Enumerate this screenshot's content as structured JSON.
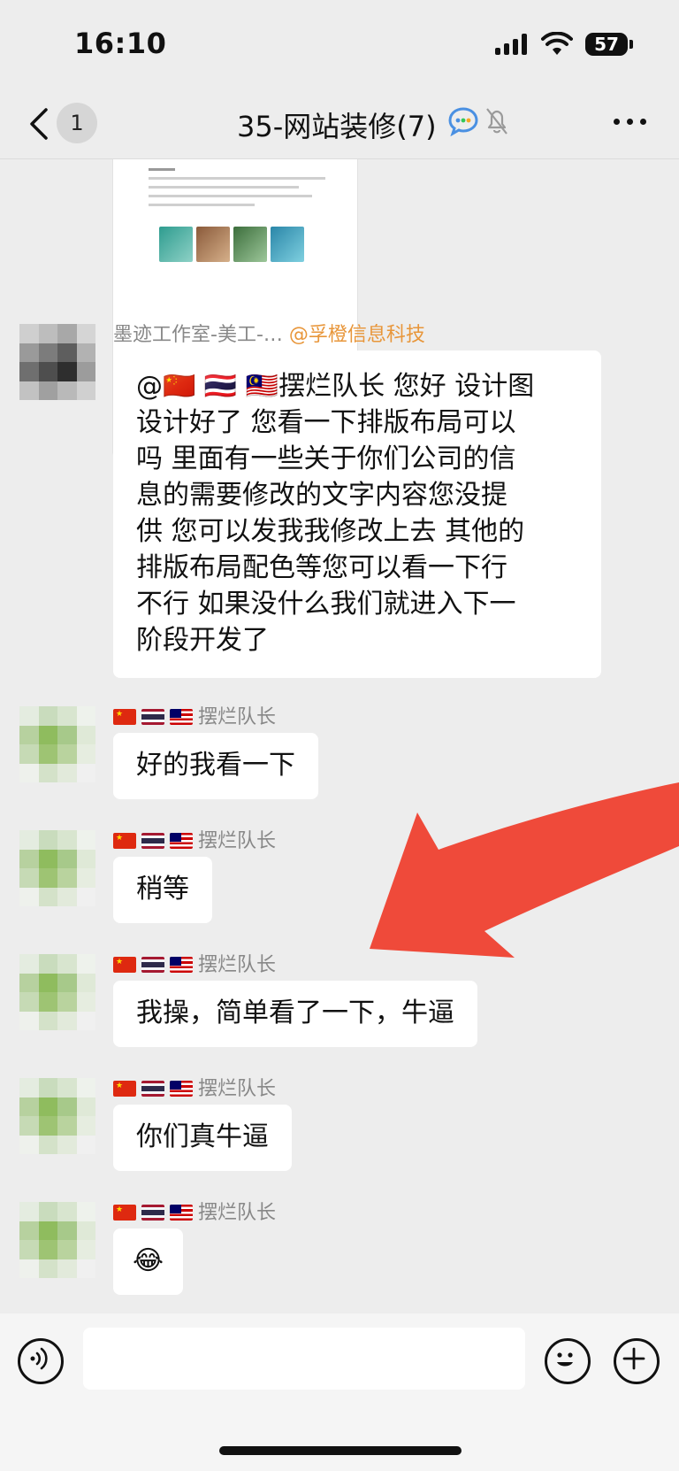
{
  "status": {
    "time": "16:10",
    "battery": "57"
  },
  "header": {
    "unread_count": "1",
    "title": "35-网站装修(7)"
  },
  "messages": [
    {
      "sender": "墨迹工作室-美工-…",
      "tag": "@孚橙信息科技",
      "lines": [
        "@🇨🇳 🇹🇭 🇲🇾摆烂队长 您好 设计图",
        "设计好了 您看一下排版布局可以",
        "吗 里面有一些关于你们公司的信",
        "息的需要修改的文字内容您没提",
        "供 您可以发我我修改上去 其他的",
        "排版布局配色等您可以看一下行",
        "不行 如果没什么我们就进入下一",
        "阶段开发了"
      ]
    },
    {
      "sender": "摆烂队长",
      "text": "好的我看一下"
    },
    {
      "sender": "摆烂队长",
      "text": "稍等"
    },
    {
      "sender": "摆烂队长",
      "text": "我操，简单看了一下，牛逼"
    },
    {
      "sender": "摆烂队长",
      "text": "你们真牛逼"
    },
    {
      "sender": "摆烂队长",
      "text": "😂"
    }
  ],
  "input": {
    "placeholder": ""
  },
  "icons": [
    "back-icon",
    "group-chat-icon",
    "mute-bell-icon",
    "more-icon",
    "voice-icon",
    "emoji-icon",
    "plus-icon"
  ],
  "colors": {
    "background": "#ededed",
    "bubble": "#ffffff",
    "mention": "#e8963a",
    "arrow": "#ef4a3a"
  }
}
